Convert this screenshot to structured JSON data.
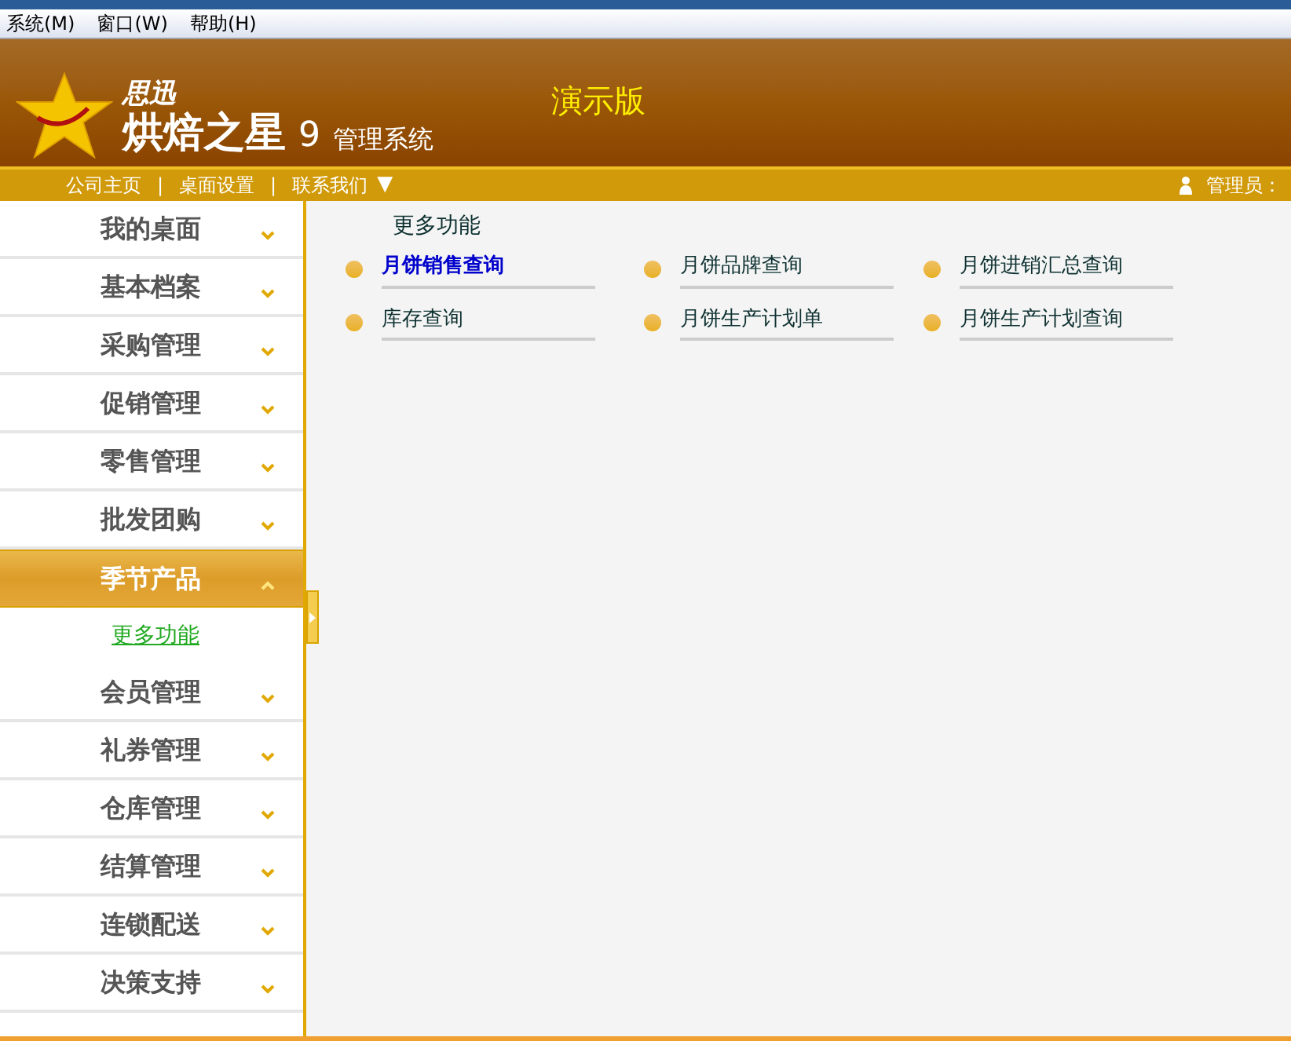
{
  "menu_bar": [
    "系统(M)",
    "窗口(W)",
    "帮助(H)"
  ],
  "header": {
    "brand_small": "思迅",
    "brand_large": "烘焙之星",
    "version": "9",
    "subtitle": "管理系统",
    "edition": "演示版"
  },
  "nav_links": [
    {
      "label": "公司主页",
      "separator": "|"
    },
    {
      "label": "桌面设置",
      "separator": "|"
    },
    {
      "label": "联系我们",
      "dropdown": "▼"
    }
  ],
  "user": {
    "label": "管理员："
  },
  "sidebar": {
    "items": [
      {
        "label": "我的桌面",
        "expanded": false
      },
      {
        "label": "基本档案",
        "expanded": false
      },
      {
        "label": "采购管理",
        "expanded": false
      },
      {
        "label": "促销管理",
        "expanded": false
      },
      {
        "label": "零售管理",
        "expanded": false
      },
      {
        "label": "批发团购",
        "expanded": false
      },
      {
        "label": "季节产品",
        "expanded": true,
        "children": [
          {
            "label": "更多功能"
          }
        ]
      },
      {
        "label": "会员管理",
        "expanded": false
      },
      {
        "label": "礼券管理",
        "expanded": false
      },
      {
        "label": "仓库管理",
        "expanded": false
      },
      {
        "label": "结算管理",
        "expanded": false
      },
      {
        "label": "连锁配送",
        "expanded": false
      },
      {
        "label": "决策支持",
        "expanded": false
      }
    ]
  },
  "content": {
    "title": "更多功能",
    "links": [
      {
        "label": "月饼销售查询",
        "selected": true
      },
      {
        "label": "月饼品牌查询",
        "selected": false
      },
      {
        "label": "月饼进销汇总查询",
        "selected": false
      },
      {
        "label": "库存查询",
        "selected": false
      },
      {
        "label": "月饼生产计划单",
        "selected": false
      },
      {
        "label": "月饼生产计划查询",
        "selected": false
      }
    ]
  }
}
